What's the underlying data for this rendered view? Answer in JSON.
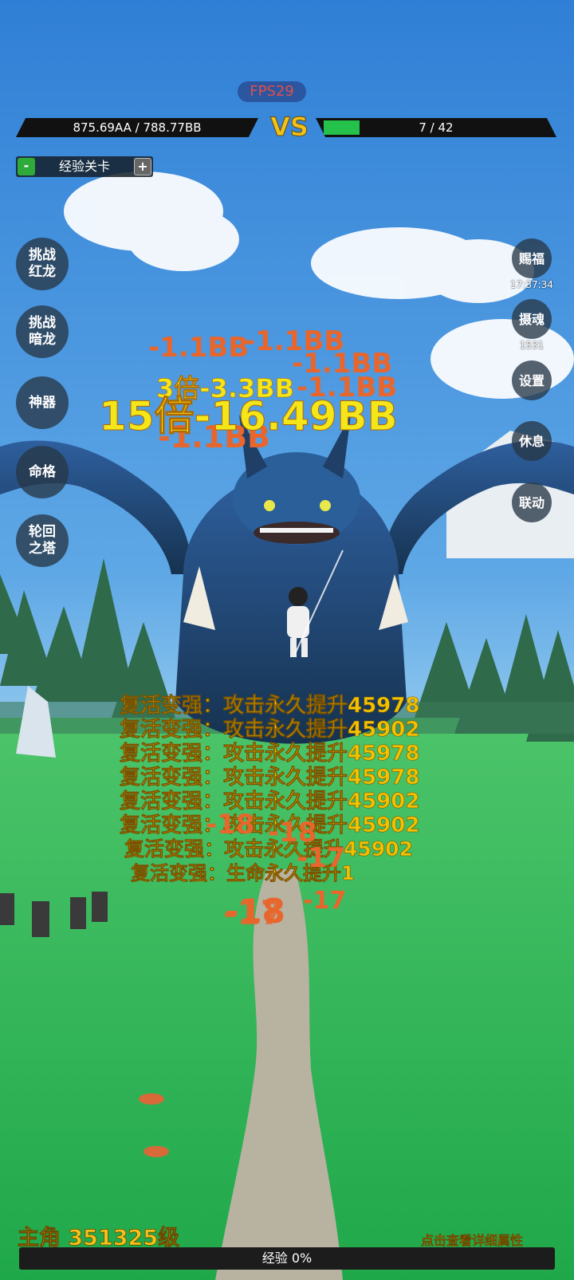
{
  "fps": "FPS29",
  "player_bar": {
    "text": "875.69AA / 788.77BB"
  },
  "vs": "VS",
  "enemy_bar": {
    "text": "7 / 42",
    "fill_fraction": 0.11,
    "fill_color": "#24c24a"
  },
  "level_selector": {
    "minus": "-",
    "label": "经验关卡",
    "plus": "+"
  },
  "left_menu": [
    {
      "label": "挑战\n红龙"
    },
    {
      "label": "挑战\n暗龙"
    },
    {
      "label": "神器"
    },
    {
      "label": "命格"
    },
    {
      "label": "轮回\n之塔"
    }
  ],
  "right_menu": {
    "blessing": "赐福",
    "blessing_timer": "17:37:34",
    "soul": "摄魂",
    "soul_count": "1531",
    "settings": "设置",
    "rest": "休息",
    "link": "联动"
  },
  "damage_numbers": {
    "d1": "-1.1BB",
    "d2": "-1.1BB",
    "d3": "-1.1BB",
    "d4": "-1.1BB",
    "d5": "3倍-3.3BB",
    "d6": "-1.1BB",
    "crit": "15倍-16.49BB",
    "d7": "-1.1BB",
    "s1": "-18",
    "s2": "-18",
    "s3": "-17",
    "s4": "-18",
    "s5": "-17",
    "s6": "-17"
  },
  "buff_messages": [
    "复活变强：攻击永久提升45978",
    "复活变强：攻击永久提升45902",
    "复活变强：攻击永久提升45978",
    "复活变强：攻击永久提升45978",
    "复活变强：攻击永久提升45902",
    "复活变强：攻击永久提升45902",
    "复活变强：攻击永久提升45902",
    "复活变强：生命永久提升1"
  ],
  "hero_level": "主角 351325级",
  "detail_link": "点击查看详细属性",
  "exp_bar": {
    "text": "经验 0%",
    "fill_fraction": 0
  },
  "colors": {
    "gold": "#f2c21a",
    "damage_orange": "#e8662c",
    "crit_yellow": "#f5e61a"
  }
}
